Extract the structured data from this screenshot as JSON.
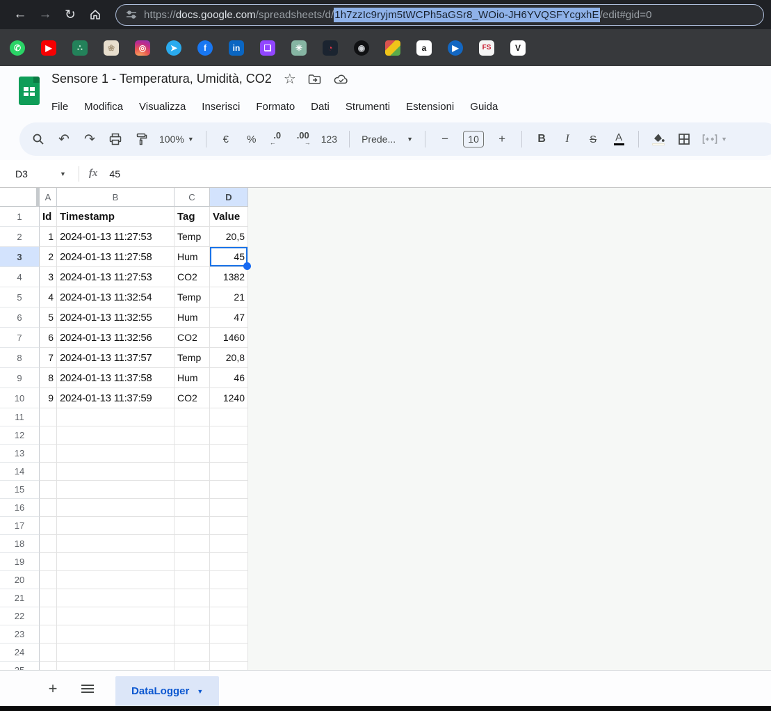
{
  "browser": {
    "nav": {
      "back": "←",
      "forward": "→",
      "reload": "↻",
      "home": "⌂"
    },
    "url_scheme": "https://",
    "url_domain": "docs.google.com",
    "url_path": "/spreadsheets/d/",
    "url_selected": "1h7zzIc9ryjm5tWCPh5aGSr8_WOio-JH6YVQSFYcgxhE",
    "url_suffix": "/edit#gid=0",
    "url_selection_bg": "#8fb2e9",
    "bookmarks": [
      {
        "name": "whatsapp",
        "bg": "#2ad366",
        "fg": "#ffffff",
        "glyph": "✆",
        "shape": "circle"
      },
      {
        "name": "youtube",
        "bg": "#f60002",
        "fg": "#ffffff",
        "glyph": "▶",
        "shape": "rounded"
      },
      {
        "name": "green-app",
        "bg": "#23825a",
        "fg": "#d7f5e3",
        "glyph": "∴",
        "shape": "rounded"
      },
      {
        "name": "shell",
        "bg": "#e7decd",
        "fg": "#a8987d",
        "glyph": "❀",
        "shape": "rounded"
      },
      {
        "name": "instagram",
        "bg": "gradient",
        "fg": "#ffffff",
        "glyph": "◎",
        "shape": "rounded"
      },
      {
        "name": "telegram",
        "bg": "#2aabee",
        "fg": "#ffffff",
        "glyph": "➤",
        "shape": "circle"
      },
      {
        "name": "facebook",
        "bg": "#1877f2",
        "fg": "#ffffff",
        "glyph": "f",
        "shape": "circle"
      },
      {
        "name": "linkedin",
        "bg": "#0a66c2",
        "fg": "#ffffff",
        "glyph": "in",
        "shape": "rounded"
      },
      {
        "name": "twitch",
        "bg": "#9146ff",
        "fg": "#ffffff",
        "glyph": "❏",
        "shape": "rounded"
      },
      {
        "name": "chatgpt",
        "bg": "#86b5a3",
        "fg": "#ffffff",
        "glyph": "✳",
        "shape": "rounded"
      },
      {
        "name": "gauge-app",
        "bg": "#1b2430",
        "fg": "#e8374a",
        "glyph": "◔",
        "shape": "rounded"
      },
      {
        "name": "badge-app",
        "bg": "#101113",
        "fg": "#cfd2d6",
        "glyph": "◉",
        "shape": "circle"
      },
      {
        "name": "stripes-app",
        "bg": "stripes",
        "fg": "#ffffff",
        "glyph": "",
        "shape": "rounded"
      },
      {
        "name": "amazon",
        "bg": "#ffffff",
        "fg": "#111111",
        "glyph": "a",
        "shape": "rounded"
      },
      {
        "name": "rai-play",
        "bg": "#1367c2",
        "fg": "#ffffff",
        "glyph": "▶",
        "shape": "circle"
      },
      {
        "name": "trenitalia",
        "bg": "#f4f4f4",
        "fg": "#c81b2e",
        "glyph": "FS",
        "shape": "rounded"
      },
      {
        "name": "vinted",
        "bg": "#ffffff",
        "fg": "#161616",
        "glyph": "V",
        "shape": "rounded"
      }
    ]
  },
  "header": {
    "title": "Sensore 1 - Temperatura, Umidità, CO2",
    "star_icon": "☆",
    "menus": [
      "File",
      "Modifica",
      "Visualizza",
      "Inserisci",
      "Formato",
      "Dati",
      "Strumenti",
      "Estensioni",
      "Guida"
    ]
  },
  "toolbar": {
    "zoom": "100%",
    "currency": "€",
    "percent": "%",
    "decrease_decimal": ".0",
    "decrease_decimal_arrow": "←",
    "increase_decimal": ".00",
    "increase_decimal_arrow": "→",
    "number_format_label": "123",
    "font_name": "Prede...",
    "minus": "−",
    "font_size": "10",
    "plus": "+",
    "bold": "B",
    "italic": "I",
    "strikethrough": "S",
    "text_color": "A",
    "undo": "↶",
    "redo": "↷"
  },
  "formula_bar": {
    "name_box": "D3",
    "fx": "fx",
    "value": "45"
  },
  "grid": {
    "col_headers": [
      "A",
      "B",
      "C",
      "D"
    ],
    "selected_col": "D",
    "selected_row": 3,
    "selected_cell": "D3",
    "header_row": [
      "Id",
      "Timestamp",
      "Tag",
      "Value"
    ],
    "rows": [
      [
        "1",
        "2024-01-13 11:27:53",
        "Temp",
        "20,5"
      ],
      [
        "2",
        "2024-01-13 11:27:58",
        "Hum",
        "45"
      ],
      [
        "3",
        "2024-01-13 11:27:53",
        "CO2",
        "1382"
      ],
      [
        "4",
        "2024-01-13 11:32:54",
        "Temp",
        "21"
      ],
      [
        "5",
        "2024-01-13 11:32:55",
        "Hum",
        "47"
      ],
      [
        "6",
        "2024-01-13 11:32:56",
        "CO2",
        "1460"
      ],
      [
        "7",
        "2024-01-13 11:37:57",
        "Temp",
        "20,8"
      ],
      [
        "8",
        "2024-01-13 11:37:58",
        "Hum",
        "46"
      ],
      [
        "9",
        "2024-01-13 11:37:59",
        "CO2",
        "1240"
      ]
    ],
    "visible_row_count": 25
  },
  "tab_bar": {
    "add_tab": "+",
    "active_tab": "DataLogger"
  },
  "colors": {
    "accent": "#1a73e8",
    "selection_header_bg": "#d3e3fd",
    "sheets_green": "#0f9d58",
    "tab_bg": "#dce6f8",
    "tab_text": "#0b57d0",
    "toolbar_bg": "#edf2fa",
    "chrome_bar_bg": "#1f2125",
    "bookmarks_bar_bg": "#37393c"
  }
}
